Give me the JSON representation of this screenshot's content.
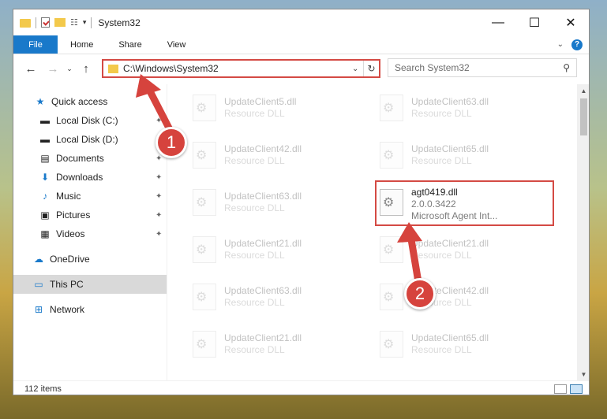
{
  "window": {
    "title": "System32"
  },
  "ribbon": {
    "tabs": [
      "File",
      "Home",
      "Share",
      "View"
    ]
  },
  "address": {
    "path": "C:\\Windows\\System32"
  },
  "search": {
    "placeholder": "Search System32"
  },
  "nav": {
    "items": [
      {
        "label": "Quick access",
        "icon": "star-icon"
      },
      {
        "label": "Local Disk (C:)",
        "icon": "drive-icon"
      },
      {
        "label": "Local Disk (D:)",
        "icon": "drive-icon"
      },
      {
        "label": "Documents",
        "icon": "documents-icon"
      },
      {
        "label": "Downloads",
        "icon": "download-icon"
      },
      {
        "label": "Music",
        "icon": "music-icon"
      },
      {
        "label": "Pictures",
        "icon": "pictures-icon"
      },
      {
        "label": "Videos",
        "icon": "videos-icon"
      },
      {
        "label": "OneDrive",
        "icon": "cloud-icon"
      },
      {
        "label": "This PC",
        "icon": "computer-icon"
      },
      {
        "label": "Network",
        "icon": "network-icon"
      }
    ]
  },
  "files": {
    "left": [
      {
        "name": "UpdateClient5.dll",
        "type": "Resource DLL"
      },
      {
        "name": "UpdateClient42.dll",
        "type": "Resource DLL"
      },
      {
        "name": "UpdateClient63.dll",
        "type": "Resource DLL"
      },
      {
        "name": "UpdateClient21.dll",
        "type": "Resource DLL"
      },
      {
        "name": "UpdateClient63.dll",
        "type": "Resource DLL"
      },
      {
        "name": "UpdateClient21.dll",
        "type": "Resource DLL"
      }
    ],
    "right": [
      {
        "name": "UpdateClient63.dll",
        "type": "Resource DLL"
      },
      {
        "name": "UpdateClient65.dll",
        "type": "Resource DLL"
      },
      {
        "name": "agt0419.dll",
        "version": "2.0.0.3422",
        "description": "Microsoft Agent Int..."
      },
      {
        "name": "UpdateClient21.dll",
        "type": "Resource DLL"
      },
      {
        "name": "UpdateClient42.dll",
        "type": "Resource DLL"
      },
      {
        "name": "UpdateClient65.dll",
        "type": "Resource DLL"
      }
    ]
  },
  "status": {
    "items": "112 items"
  },
  "annotations": {
    "step1": "1",
    "step2": "2"
  },
  "colors": {
    "highlight": "#d44a44",
    "accent": "#1979ca"
  }
}
